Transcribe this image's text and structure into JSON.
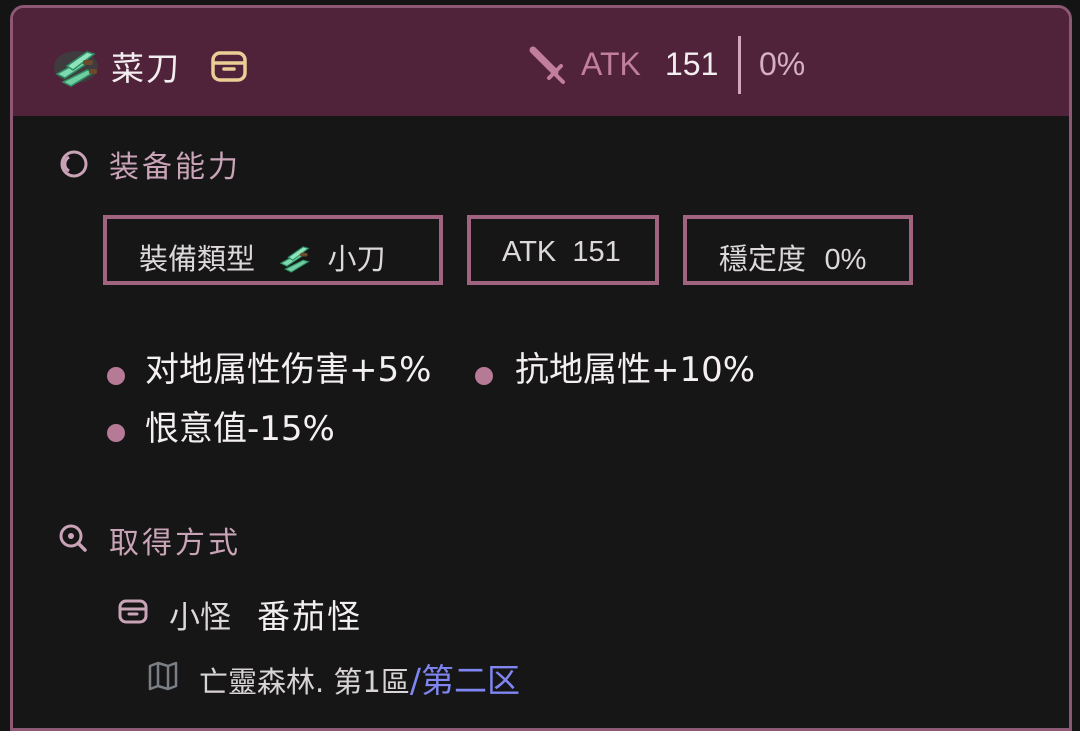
{
  "header": {
    "item_name": "菜刀",
    "item_icon": "knife-icon",
    "source_icon": "treasure-bag-icon",
    "weapon_icon": "sword-icon",
    "atk_label": "ATK",
    "atk_value": "151",
    "stability_value": "0%",
    "colors": {
      "background": "#51233a",
      "border": "#8c5874",
      "accent": "#c17f9c"
    }
  },
  "equip_section": {
    "title": "装备能力",
    "icon": "ring-icon",
    "type_label": "裝備類型",
    "type_value": "小刀",
    "type_icon": "knife-icon",
    "atk_label": "ATK",
    "atk_value": "151",
    "stability_label": "穩定度",
    "stability_value": "0%",
    "properties": [
      {
        "text": "对地属性伤害+5%"
      },
      {
        "text": "抗地属性+10%"
      },
      {
        "text": "恨意值-15%"
      }
    ]
  },
  "source_section": {
    "title": "取得方式",
    "icon": "search-icon",
    "sources": [
      {
        "icon": "treasure-bag-icon",
        "type": "小怪",
        "name": "番茄怪",
        "location_icon": "map-icon",
        "location_text": "亡靈森林. 第1區",
        "location_link": "/第二区"
      }
    ]
  }
}
